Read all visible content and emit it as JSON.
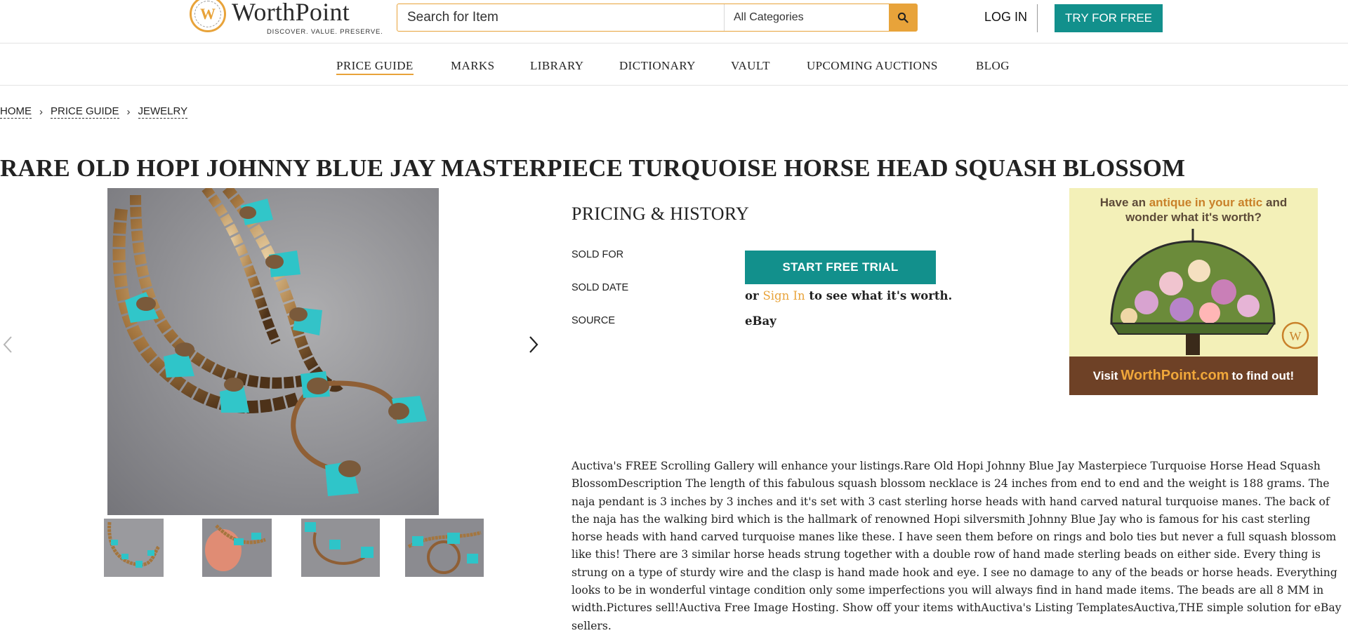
{
  "header": {
    "logo_name": "WorthPoint",
    "logo_tagline": "DISCOVER. VALUE. PRESERVE.",
    "search_placeholder": "Search for Item",
    "category_selected": "All Categories",
    "search_icon": "search-icon",
    "login_label": "LOG IN",
    "try_label": "TRY FOR FREE"
  },
  "nav": {
    "items": [
      "PRICE GUIDE",
      "MARKS",
      "LIBRARY",
      "DICTIONARY",
      "VAULT",
      "UPCOMING AUCTIONS",
      "BLOG"
    ],
    "active": "PRICE GUIDE"
  },
  "breadcrumb": [
    "HOME",
    "PRICE GUIDE",
    "JEWELRY"
  ],
  "title": "RARE OLD HOPI JOHNNY BLUE JAY MASTERPIECE TURQUOISE HORSE HEAD SQUASH BLOSSOM",
  "gallery": {
    "prev_icon": "chevron-left-icon",
    "next_icon": "chevron-right-icon",
    "thumbnail_count": 4
  },
  "pricing": {
    "heading": "PRICING & HISTORY",
    "sold_for_label": "SOLD FOR",
    "sold_date_label": "SOLD DATE",
    "source_label": "SOURCE",
    "trial_button": "START FREE TRIAL",
    "or_text": "or",
    "sign_in": "Sign In",
    "worth_text": "to see what it's worth.",
    "source_value": "eBay"
  },
  "ad": {
    "line1_a": "Have an",
    "line1_hl": "antique in your attic",
    "line1_b": "and",
    "line2": "wonder what it's worth?",
    "visit": "Visit",
    "site": "WorthPoint.com",
    "tail": "to find out!"
  },
  "description": "Auctiva's FREE Scrolling Gallery will enhance your listings.Rare Old Hopi Johnny Blue Jay Masterpiece Turquoise Horse Head Squash BlossomDescription The length of this fabulous squash blossom necklace is 24 inches from end to end and the weight is 188 grams. The naja pendant is 3 inches by 3 inches and it's set with 3 cast sterling horse heads with hand carved natural turquoise manes. The back of the naja has the walking bird which is the hallmark of renowned Hopi silversmith Johnny Blue Jay who is famous for his cast sterling horse heads with hand carved turquoise manes like these. I have seen them before on rings and bolo ties but never a full squash blossom like this! There are 3 similar horse heads strung together with a double row of hand made sterling beads on either side. Every thing is strung on a type of sturdy wire and the clasp is hand made hook and eye. I see no damage to any of the beads or horse heads. Everything looks to be in wonderful vintage condition only some imperfections you will always find in hand made items. The beads are all 8 MM in width.Pictures sell!Auctiva Free Image Hosting. Show off your items withAuctiva's Listing TemplatesAuctiva,THE simple solution for eBay sellers.",
  "colors": {
    "accent": "#e8a33a",
    "teal": "#12908c",
    "turquoise": "#2ec4c8"
  }
}
